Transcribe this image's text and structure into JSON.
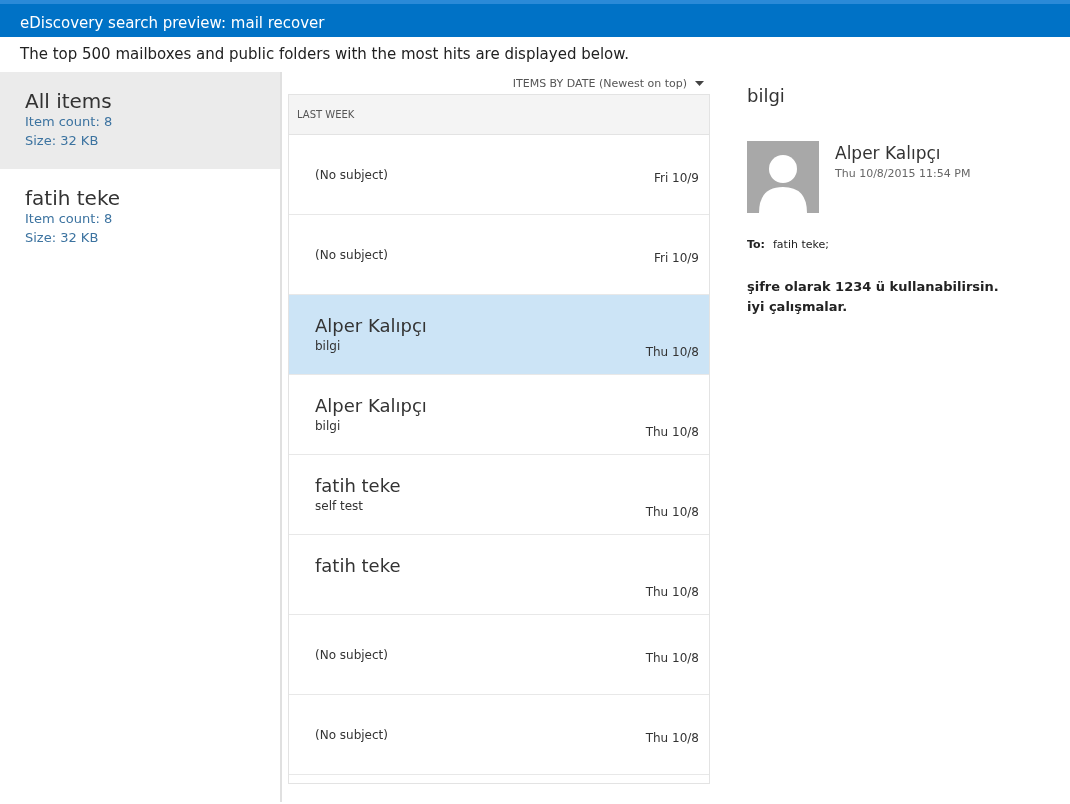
{
  "window": {
    "title": "eDiscovery search preview: mail recover"
  },
  "intro": "The top 500 mailboxes and public folders with the most hits are displayed below.",
  "mailboxes": [
    {
      "name": "All items",
      "item_count": "Item count:  8",
      "size": "Size:  32 KB",
      "selected": true
    },
    {
      "name": "fatih teke",
      "item_count": "Item count:  8",
      "size": "Size:  32 KB",
      "selected": false
    }
  ],
  "sort": {
    "label": "ITEMS BY DATE (Newest on top)"
  },
  "group_header": "LAST WEEK",
  "messages": [
    {
      "kind": "no_subject",
      "subject": "(No subject)",
      "date": "Fri 10/9",
      "selected": false
    },
    {
      "kind": "no_subject",
      "subject": "(No subject)",
      "date": "Fri 10/9",
      "selected": false
    },
    {
      "kind": "sender",
      "sender": "Alper Kalıpçı",
      "subject": "bilgi",
      "date": "Thu 10/8",
      "selected": true
    },
    {
      "kind": "sender",
      "sender": "Alper Kalıpçı",
      "subject": "bilgi",
      "date": "Thu 10/8",
      "selected": false
    },
    {
      "kind": "sender",
      "sender": "fatih teke",
      "subject": "self test",
      "date": "Thu 10/8",
      "selected": false
    },
    {
      "kind": "sender",
      "sender": "fatih teke",
      "date": "Thu 10/8",
      "selected": false
    },
    {
      "kind": "no_subject",
      "subject": "(No subject)",
      "date": "Thu 10/8",
      "selected": false
    },
    {
      "kind": "no_subject",
      "subject": "(No subject)",
      "date": "Thu 10/8",
      "selected": false
    }
  ],
  "reading_pane": {
    "subject": "bilgi",
    "sender": "Alper Kalıpçı",
    "sent": "Thu 10/8/2015 11:54 PM",
    "to_label": "To:",
    "to": "fatih teke;",
    "body": [
      "şifre olarak 1234 ü kullanabilirsin.",
      "iyi çalışmalar."
    ]
  }
}
